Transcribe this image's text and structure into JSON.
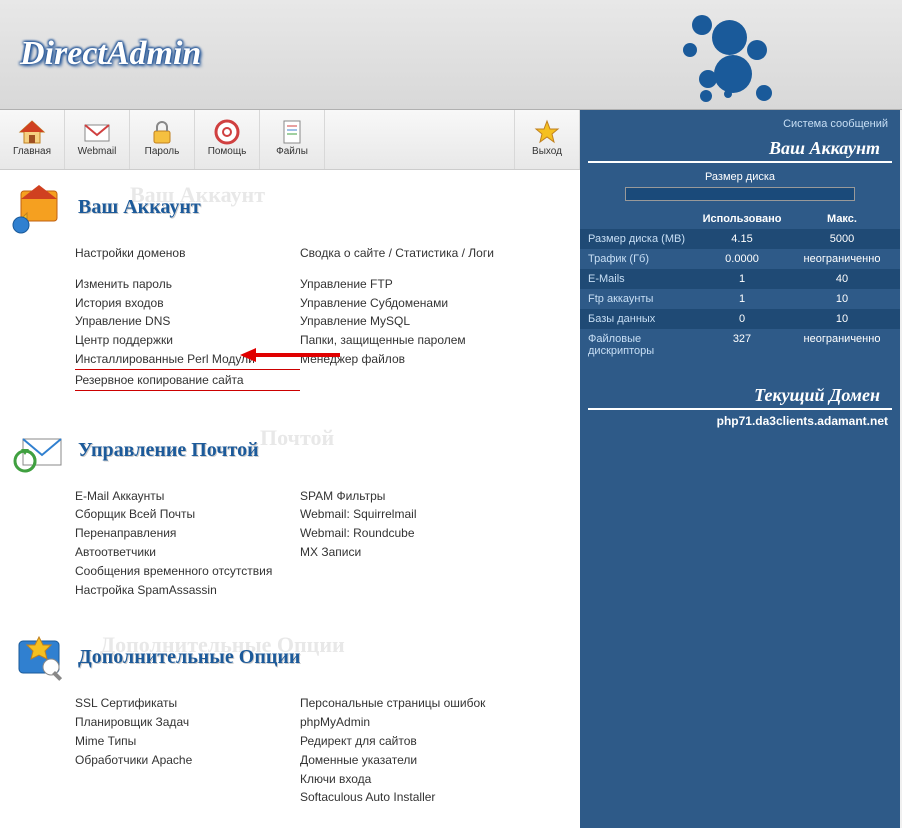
{
  "logo_text": "DirectAdmin",
  "toolbar": [
    {
      "label": "Главная",
      "icon": "home"
    },
    {
      "label": "Webmail",
      "icon": "mail"
    },
    {
      "label": "Пароль",
      "icon": "lock"
    },
    {
      "label": "Помощь",
      "icon": "help"
    },
    {
      "label": "Файлы",
      "icon": "files"
    }
  ],
  "toolbar_exit": {
    "label": "Выход",
    "icon": "star"
  },
  "sections": [
    {
      "title": "Ваш Аккаунт",
      "shadow": "Ваш Аккаунт",
      "col1": [
        "Настройки доменов",
        "",
        "Изменить пароль",
        "История входов",
        "Управление DNS",
        "Центр поддержки",
        "Инсталлированные Perl Модули",
        "Резервное копирование сайта"
      ],
      "col2": [
        "Сводка о сайте / Статистика / Логи",
        "",
        "Управление FTP",
        "Управление Субдоменами",
        "Управление MySQL",
        "Папки, защищенные паролем",
        "Менеджер файлов"
      ]
    },
    {
      "title": "Управление Почтой",
      "shadow": "Почтой",
      "col1": [
        "E-Mail Аккаунты",
        "Сборщик Всей Почты",
        "Перенаправления",
        "Автоответчики",
        "Сообщения временного отсутствия",
        "Настройка SpamAssassin"
      ],
      "col2": [
        "SPAM Фильтры",
        "Webmail: Squirrelmail",
        "Webmail: Roundcube",
        "MX Записи"
      ]
    },
    {
      "title": "Дополнительные Опции",
      "shadow": "Дополнительные Опции",
      "col1": [
        "SSL Сертификаты",
        "Планировщик Задач",
        "Mime Типы",
        "Обработчики Apache"
      ],
      "col2": [
        "Персональные страницы ошибок",
        "phpMyAdmin",
        "Редирект для сайтов",
        "Доменные указатели",
        "Ключи входа",
        "Softaculous Auto Installer"
      ]
    }
  ],
  "right": {
    "system_msgs": "Система сообщений",
    "your_account": "Ваш Аккаунт",
    "disk_label": "Размер диска",
    "used_header": "Использовано",
    "max_header": "Макс.",
    "current_domain_heading": "Текущий Домен",
    "current_domain": "php71.da3clients.adamant.net",
    "rows": [
      {
        "label": "Размер диска (MB)",
        "used": "4.15",
        "max": "5000"
      },
      {
        "label": "Трафик (Гб)",
        "used": "0.0000",
        "max": "неограниченно"
      },
      {
        "label": "E-Mails",
        "used": "1",
        "max": "40"
      },
      {
        "label": "Ftp аккаунты",
        "used": "1",
        "max": "10"
      },
      {
        "label": "Базы данных",
        "used": "0",
        "max": "10"
      },
      {
        "label": "Файловые дискрипторы",
        "used": "327",
        "max": "неограниченно"
      }
    ]
  }
}
